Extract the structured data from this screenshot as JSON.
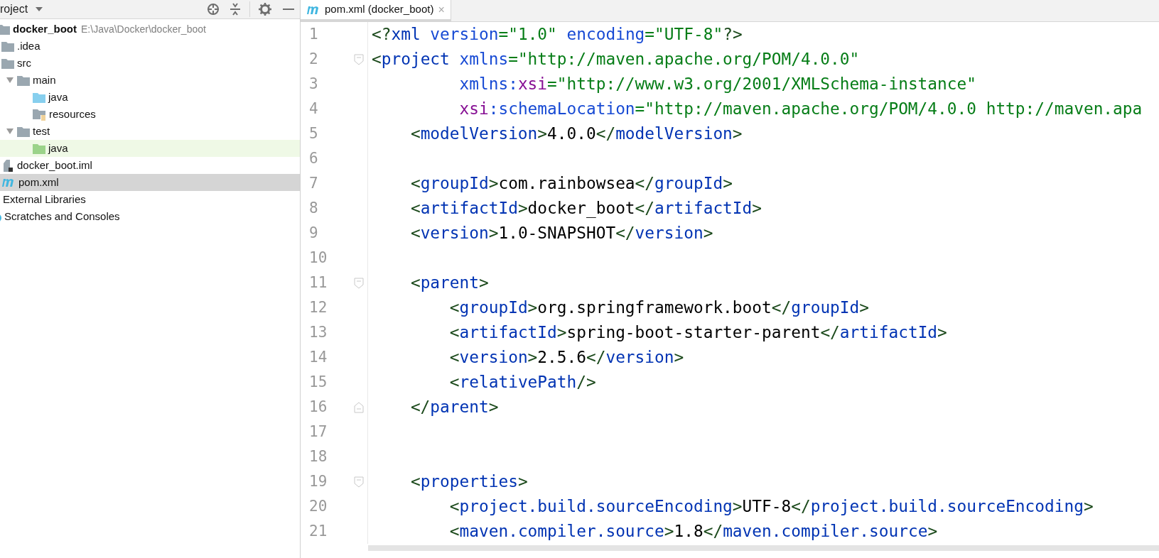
{
  "project_panel": {
    "title": "roject",
    "tree": [
      {
        "kind": "project",
        "label": "docker_boot",
        "path": "E:\\Java\\Docker\\docker_boot",
        "selected": false,
        "highlighted": false,
        "children": [
          {
            "kind": "folder",
            "label": ".idea",
            "selected": false,
            "highlighted": false
          },
          {
            "kind": "folder",
            "label": "src",
            "selected": false,
            "highlighted": false,
            "children": [
              {
                "kind": "folder",
                "label": "main",
                "expanded": true,
                "selected": false,
                "highlighted": false,
                "children": [
                  {
                    "kind": "source",
                    "label": "java",
                    "selected": false,
                    "highlighted": false
                  },
                  {
                    "kind": "resources",
                    "label": "resources",
                    "selected": false,
                    "highlighted": false
                  }
                ]
              },
              {
                "kind": "folder",
                "label": "test",
                "expanded": true,
                "selected": false,
                "highlighted": false,
                "children": [
                  {
                    "kind": "test",
                    "label": "java",
                    "selected": false,
                    "highlighted": true
                  }
                ]
              }
            ]
          },
          {
            "kind": "iml",
            "label": "docker_boot.iml",
            "selected": false,
            "highlighted": false
          },
          {
            "kind": "maven",
            "label": "pom.xml",
            "selected": true,
            "highlighted": false
          }
        ]
      },
      {
        "kind": "libraries",
        "label": "External Libraries",
        "selected": false,
        "highlighted": false
      },
      {
        "kind": "scratches",
        "label": "Scratches and Consoles",
        "selected": false,
        "highlighted": false
      }
    ]
  },
  "editor": {
    "tabs": [
      {
        "label": "pom.xml (docker_boot)",
        "close": "×",
        "selected": true
      }
    ],
    "lines": [
      {
        "number": "1",
        "tokens": [
          {
            "kind": "punct",
            "text": "<?"
          },
          {
            "kind": "tag",
            "text": "xml"
          },
          {
            "kind": "attr",
            "text": " version"
          },
          {
            "kind": "string",
            "text": "=\"1.0\""
          },
          {
            "kind": "attr",
            "text": " encoding"
          },
          {
            "kind": "string",
            "text": "=\"UTF-8\""
          },
          {
            "kind": "punct",
            "text": "?>"
          }
        ]
      },
      {
        "number": "2",
        "fold_start": true,
        "tokens": [
          {
            "kind": "punct",
            "text": "<"
          },
          {
            "kind": "tag",
            "text": "project"
          },
          {
            "kind": "attr",
            "text": " xmlns"
          },
          {
            "kind": "string",
            "text": "=\"http://maven.apache.org/POM/4.0.0\""
          }
        ]
      },
      {
        "number": "3",
        "tokens": [
          {
            "kind": "attr",
            "text": "         xmlns:"
          },
          {
            "kind": "namespace",
            "text": "xsi"
          },
          {
            "kind": "string",
            "text": "=\"http://www.w3.org/2001/XMLSchema-instance\""
          }
        ]
      },
      {
        "number": "4",
        "tokens": [
          {
            "kind": "namespace",
            "text": "         xsi"
          },
          {
            "kind": "attr",
            "text": ":schemaLocation"
          },
          {
            "kind": "string",
            "text": "=\"http://maven.apache.org/POM/4.0.0 http://maven.apa"
          }
        ]
      },
      {
        "number": "5",
        "tokens": [
          {
            "kind": "punct",
            "text": "    <"
          },
          {
            "kind": "tag",
            "text": "modelVersion"
          },
          {
            "kind": "punct",
            "text": ">"
          },
          {
            "kind": "value",
            "text": "4.0.0"
          },
          {
            "kind": "punct",
            "text": "</"
          },
          {
            "kind": "tag",
            "text": "modelVersion"
          },
          {
            "kind": "punct",
            "text": ">"
          }
        ]
      },
      {
        "number": "6"
      },
      {
        "number": "7",
        "tokens": [
          {
            "kind": "punct",
            "text": "    <"
          },
          {
            "kind": "tag",
            "text": "groupId"
          },
          {
            "kind": "punct",
            "text": ">"
          },
          {
            "kind": "value",
            "text": "com.rainbowsea"
          },
          {
            "kind": "punct",
            "text": "</"
          },
          {
            "kind": "tag",
            "text": "groupId"
          },
          {
            "kind": "punct",
            "text": ">"
          }
        ]
      },
      {
        "number": "8",
        "tokens": [
          {
            "kind": "punct",
            "text": "    <"
          },
          {
            "kind": "tag",
            "text": "artifactId"
          },
          {
            "kind": "punct",
            "text": ">"
          },
          {
            "kind": "value",
            "text": "docker_boot"
          },
          {
            "kind": "punct",
            "text": "</"
          },
          {
            "kind": "tag",
            "text": "artifactId"
          },
          {
            "kind": "punct",
            "text": ">"
          }
        ]
      },
      {
        "number": "9",
        "tokens": [
          {
            "kind": "punct",
            "text": "    <"
          },
          {
            "kind": "tag",
            "text": "version"
          },
          {
            "kind": "punct",
            "text": ">"
          },
          {
            "kind": "value",
            "text": "1.0-SNAPSHOT"
          },
          {
            "kind": "punct",
            "text": "</"
          },
          {
            "kind": "tag",
            "text": "version"
          },
          {
            "kind": "punct",
            "text": ">"
          }
        ]
      },
      {
        "number": "10"
      },
      {
        "number": "11",
        "fold_start": true,
        "tokens": [
          {
            "kind": "punct",
            "text": "    <"
          },
          {
            "kind": "tag",
            "text": "parent"
          },
          {
            "kind": "punct",
            "text": ">"
          }
        ]
      },
      {
        "number": "12",
        "tokens": [
          {
            "kind": "punct",
            "text": "        <"
          },
          {
            "kind": "tag",
            "text": "groupId"
          },
          {
            "kind": "punct",
            "text": ">"
          },
          {
            "kind": "value",
            "text": "org.springframework.boot"
          },
          {
            "kind": "punct",
            "text": "</"
          },
          {
            "kind": "tag",
            "text": "groupId"
          },
          {
            "kind": "punct",
            "text": ">"
          }
        ]
      },
      {
        "number": "13",
        "tokens": [
          {
            "kind": "punct",
            "text": "        <"
          },
          {
            "kind": "tag",
            "text": "artifactId"
          },
          {
            "kind": "punct",
            "text": ">"
          },
          {
            "kind": "value",
            "text": "spring-boot-starter-parent"
          },
          {
            "kind": "punct",
            "text": "</"
          },
          {
            "kind": "tag",
            "text": "artifactId"
          },
          {
            "kind": "punct",
            "text": ">"
          }
        ]
      },
      {
        "number": "14",
        "tokens": [
          {
            "kind": "punct",
            "text": "        <"
          },
          {
            "kind": "tag",
            "text": "version"
          },
          {
            "kind": "punct",
            "text": ">"
          },
          {
            "kind": "value",
            "text": "2.5.6"
          },
          {
            "kind": "punct",
            "text": "</"
          },
          {
            "kind": "tag",
            "text": "version"
          },
          {
            "kind": "punct",
            "text": ">"
          }
        ]
      },
      {
        "number": "15",
        "tokens": [
          {
            "kind": "punct",
            "text": "        <"
          },
          {
            "kind": "tag",
            "text": "relativePath"
          },
          {
            "kind": "punct",
            "text": "/>"
          }
        ]
      },
      {
        "number": "16",
        "fold_end": true,
        "tokens": [
          {
            "kind": "punct",
            "text": "    </"
          },
          {
            "kind": "tag",
            "text": "parent"
          },
          {
            "kind": "punct",
            "text": ">"
          }
        ]
      },
      {
        "number": "17"
      },
      {
        "number": "18"
      },
      {
        "number": "19",
        "fold_start": true,
        "tokens": [
          {
            "kind": "punct",
            "text": "    <"
          },
          {
            "kind": "tag",
            "text": "properties"
          },
          {
            "kind": "punct",
            "text": ">"
          }
        ]
      },
      {
        "number": "20",
        "tokens": [
          {
            "kind": "punct",
            "text": "        <"
          },
          {
            "kind": "tag",
            "text": "project.build.sourceEncoding"
          },
          {
            "kind": "punct",
            "text": ">"
          },
          {
            "kind": "value",
            "text": "UTF-8"
          },
          {
            "kind": "punct",
            "text": "</"
          },
          {
            "kind": "tag",
            "text": "project.build.sourceEncoding"
          },
          {
            "kind": "punct",
            "text": ">"
          }
        ]
      },
      {
        "number": "21",
        "tokens": [
          {
            "kind": "punct",
            "text": "        <"
          },
          {
            "kind": "tag",
            "text": "maven.compiler.source"
          },
          {
            "kind": "punct",
            "text": ">"
          },
          {
            "kind": "value",
            "text": "1.8"
          },
          {
            "kind": "punct",
            "text": "</"
          },
          {
            "kind": "tag",
            "text": "maven.compiler.source"
          },
          {
            "kind": "punct",
            "text": ">"
          }
        ]
      }
    ]
  }
}
